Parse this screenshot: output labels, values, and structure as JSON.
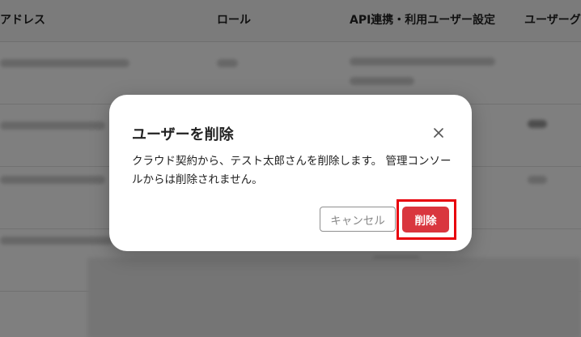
{
  "table": {
    "headers": {
      "email": "アドレス",
      "role": "ロール",
      "api": "API連携・利用ユーザー設定",
      "group": "ユーザーグ"
    }
  },
  "dialog": {
    "title": "ユーザーを削除",
    "message": "クラウド契約から、テスト太郎さんを削除します。 管理コンソールからは削除されません。",
    "cancel_label": "キャンセル",
    "delete_label": "削除",
    "close_icon": "close-icon",
    "colors": {
      "delete_button": "#d9363e",
      "highlight": "#e8000b"
    }
  }
}
